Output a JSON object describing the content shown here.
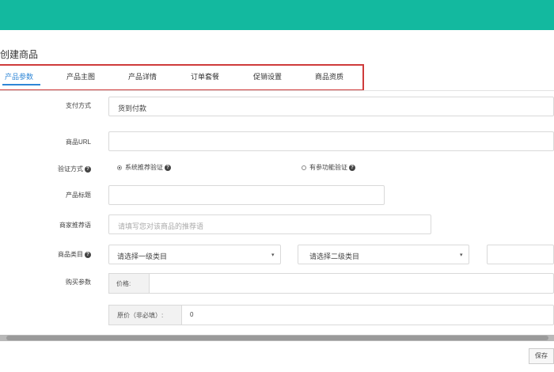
{
  "page": {
    "title": "创建商品"
  },
  "tabs": [
    {
      "label": "产品参数",
      "active": true
    },
    {
      "label": "产品主图",
      "active": false
    },
    {
      "label": "产品详情",
      "active": false
    },
    {
      "label": "订单套餐",
      "active": false
    },
    {
      "label": "促销设置",
      "active": false
    },
    {
      "label": "商品资质",
      "active": false
    }
  ],
  "form": {
    "payment": {
      "label": "支付方式",
      "value": "货到付款"
    },
    "product_url": {
      "label": "商品URL",
      "value": ""
    },
    "verify": {
      "label": "验证方式",
      "options": [
        {
          "label": "系统推荐验证",
          "checked": true
        },
        {
          "label": "有参功能验证",
          "checked": false
        }
      ]
    },
    "product_title": {
      "label": "产品标题",
      "value": ""
    },
    "recommend": {
      "label": "商家推荐语",
      "placeholder": "请填写您对该商品的推荐语"
    },
    "category": {
      "label": "商品类目",
      "level1": "请选择一级类目",
      "level2": "请选择二级类目"
    },
    "purchase": {
      "label": "购买参数",
      "price_label": "价格:",
      "original_price_label": "原价（非必填）:",
      "original_price_value": "0"
    }
  },
  "footer": {
    "save_label": "保存"
  },
  "colors": {
    "topbar": "#13b99f",
    "active_tab": "#2f86d6",
    "highlight_border": "#cf3b3b"
  }
}
